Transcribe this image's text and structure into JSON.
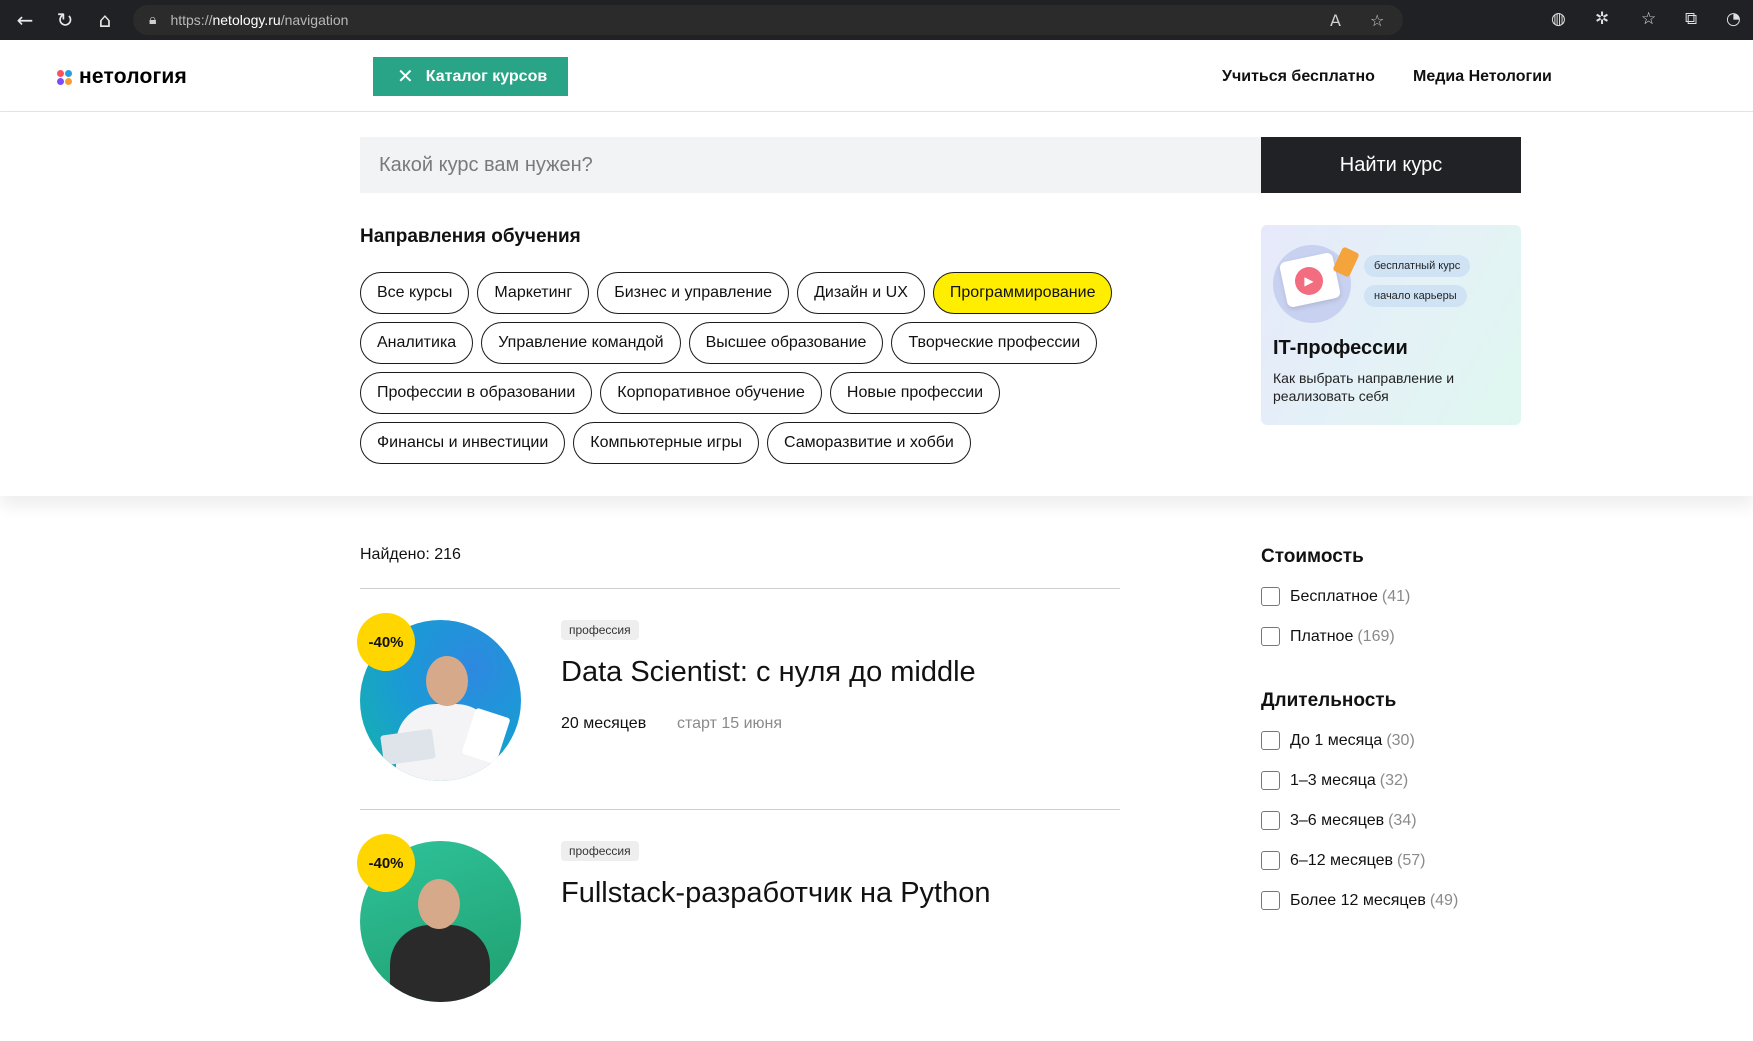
{
  "browser": {
    "url_prefix": "https://",
    "url_host": "netology.ru",
    "url_path": "/navigation"
  },
  "header": {
    "logo_text": "нетология",
    "catalog_label": "Каталог курсов",
    "links": [
      "Учиться бесплатно",
      "Медиа Нетологии"
    ]
  },
  "panel": {
    "search_placeholder": "Какой курс вам нужен?",
    "search_button": "Найти курс",
    "directions_title": "Направления обучения",
    "chip_rows": [
      [
        "Все курсы",
        "Маркетинг",
        "Бизнес и управление",
        "Дизайн и UX",
        "Программирование"
      ],
      [
        "Аналитика",
        "Управление командой",
        "Высшее образование",
        "Творческие профессии"
      ],
      [
        "Профессии в образовании",
        "Корпоративное обучение",
        "Новые профессии"
      ],
      [
        "Финансы и инвестиции",
        "Компьютерные игры",
        "Саморазвитие и хобби"
      ]
    ],
    "active_chip": "Программирование",
    "promo": {
      "tags": [
        "бесплатный курс",
        "начало карьеры"
      ],
      "title": "IT-профессии",
      "description": "Как выбрать направление и реализовать себя"
    }
  },
  "results": {
    "found_label": "Найдено: 216",
    "courses": [
      {
        "discount": "-40%",
        "type": "профессия",
        "title": "Data Scientist: с нуля до middle",
        "duration": "20 месяцев",
        "start": "старт 15 июня"
      },
      {
        "discount": "-40%",
        "type": "профессия",
        "title": "Fullstack-разработчик на Python"
      }
    ]
  },
  "filters": {
    "cost": {
      "title": "Стоимость",
      "options": [
        {
          "label": "Бесплатное",
          "count": "(41)"
        },
        {
          "label": "Платное",
          "count": "(169)"
        }
      ]
    },
    "duration": {
      "title": "Длительность",
      "options": [
        {
          "label": "До 1 месяца",
          "count": "(30)"
        },
        {
          "label": "1–3 месяца",
          "count": "(32)"
        },
        {
          "label": "3–6 месяцев",
          "count": "(34)"
        },
        {
          "label": "6–12 месяцев",
          "count": "(57)"
        },
        {
          "label": "Более 12 месяцев",
          "count": "(49)"
        }
      ]
    }
  },
  "colors": {
    "brand_green": "#2aa486",
    "active_chip": "#ffee00",
    "discount_badge": "#ffd600",
    "search_button": "#202226"
  }
}
